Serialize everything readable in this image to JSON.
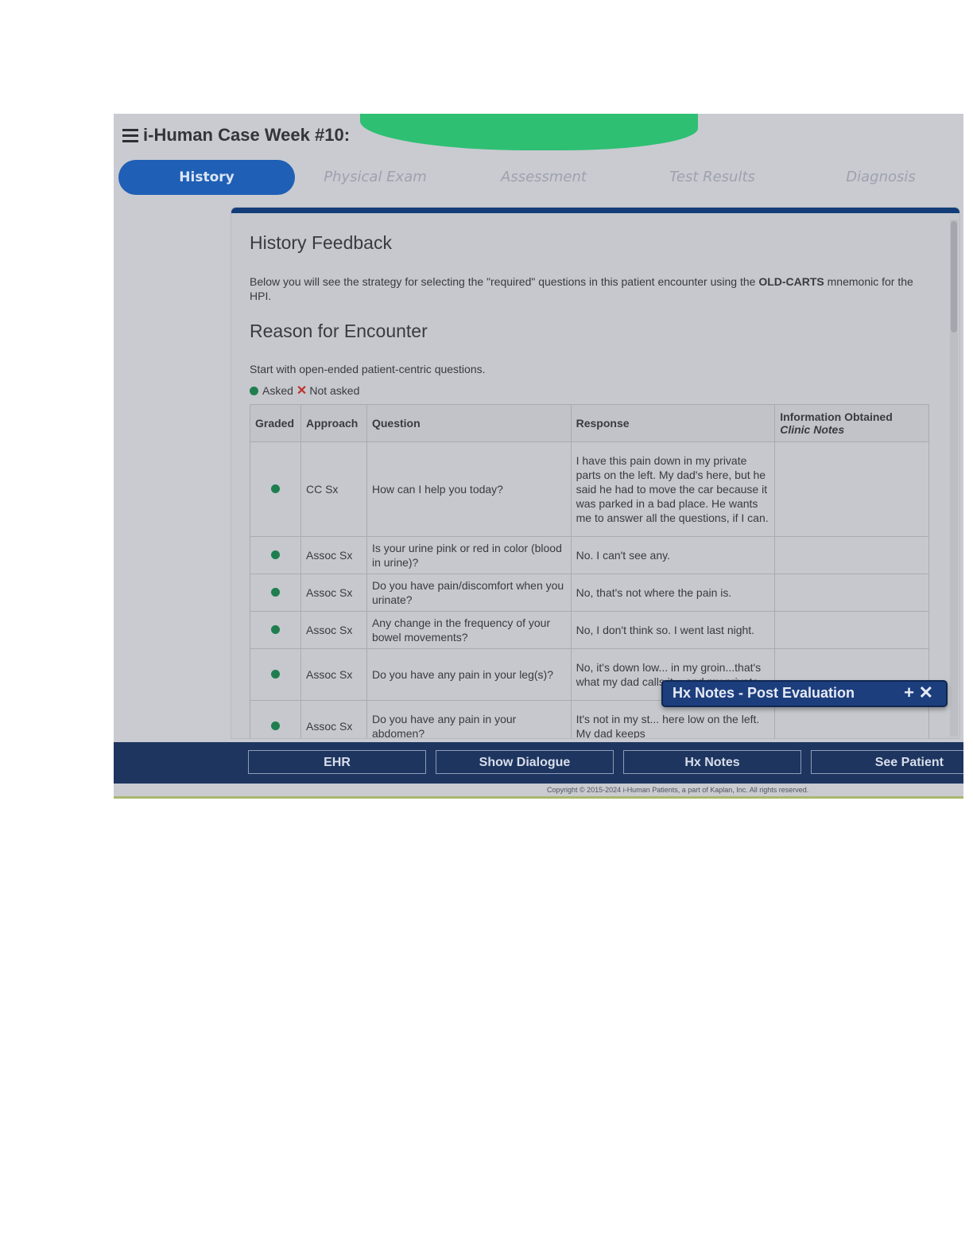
{
  "app": {
    "title": "i-Human Case Week #10: ",
    "menu_icon": "hamburger-menu-icon"
  },
  "tabs": [
    {
      "label": "History",
      "active": true
    },
    {
      "label": "Physical Exam",
      "active": false
    },
    {
      "label": "Assessment",
      "active": false
    },
    {
      "label": "Test Results",
      "active": false
    },
    {
      "label": "Diagnosis",
      "active": false
    }
  ],
  "feedback": {
    "title": "History Feedback",
    "intro_prefix": "Below you will see the strategy for selecting the \"required\" questions in this patient encounter using the ",
    "intro_bold": "OLD-CARTS",
    "intro_suffix": " mnemonic for the HPI.",
    "section_title": "Reason for Encounter",
    "start_text": "Start with open-ended patient-centric questions.",
    "legend_asked": "Asked",
    "legend_not_asked": "Not asked"
  },
  "table": {
    "headers": {
      "graded": "Graded",
      "approach": "Approach",
      "question": "Question",
      "response": "Response",
      "info_line1": "Information Obtained",
      "info_line2": "Clinic Notes"
    },
    "rows": [
      {
        "approach": "CC Sx",
        "question": "How can I help you today?",
        "response": "I have this pain down in my private parts on the left. My dad's here, but he said he had to move the car because it was parked in a bad place. He wants me to answer all the questions, if I can.",
        "info": ""
      },
      {
        "approach": "Assoc Sx",
        "question": "Is your urine pink or red in color (blood in urine)?",
        "response": "No. I can't see any.",
        "info": ""
      },
      {
        "approach": "Assoc Sx",
        "question": "Do you have pain/discomfort when you urinate?",
        "response": "No, that's not where the pain is.",
        "info": ""
      },
      {
        "approach": "Assoc Sx",
        "question": "Any change in the frequency of your bowel movements?",
        "response": "No, I don't think so. I went last night.",
        "info": ""
      },
      {
        "approach": "Assoc Sx",
        "question": "Do you have any pain in your leg(s)?",
        "response": "No, it's down low... in my groin...that's what my dad calls it... and my private",
        "info": ""
      },
      {
        "approach": "Assoc Sx",
        "question": "Do you have any pain in your abdomen?",
        "response": "It's not in my st... here low on the left. My dad keeps",
        "info": ""
      }
    ]
  },
  "popup": {
    "title": "Hx Notes - Post Evaluation",
    "plus": "+",
    "close": "✕"
  },
  "footer": {
    "buttons": [
      "EHR",
      "Show Dialogue",
      "Hx Notes",
      "See Patient"
    ],
    "copyright": "Copyright © 2015-2024 i-Human Patients, a part of Kaplan, Inc. All rights reserved."
  },
  "colors": {
    "accent": "#1f5fb5",
    "asked_dot": "#1f7e4f",
    "not_asked_x": "#c0312c",
    "redaction": "#2ebf73",
    "footer": "#1e355f"
  }
}
